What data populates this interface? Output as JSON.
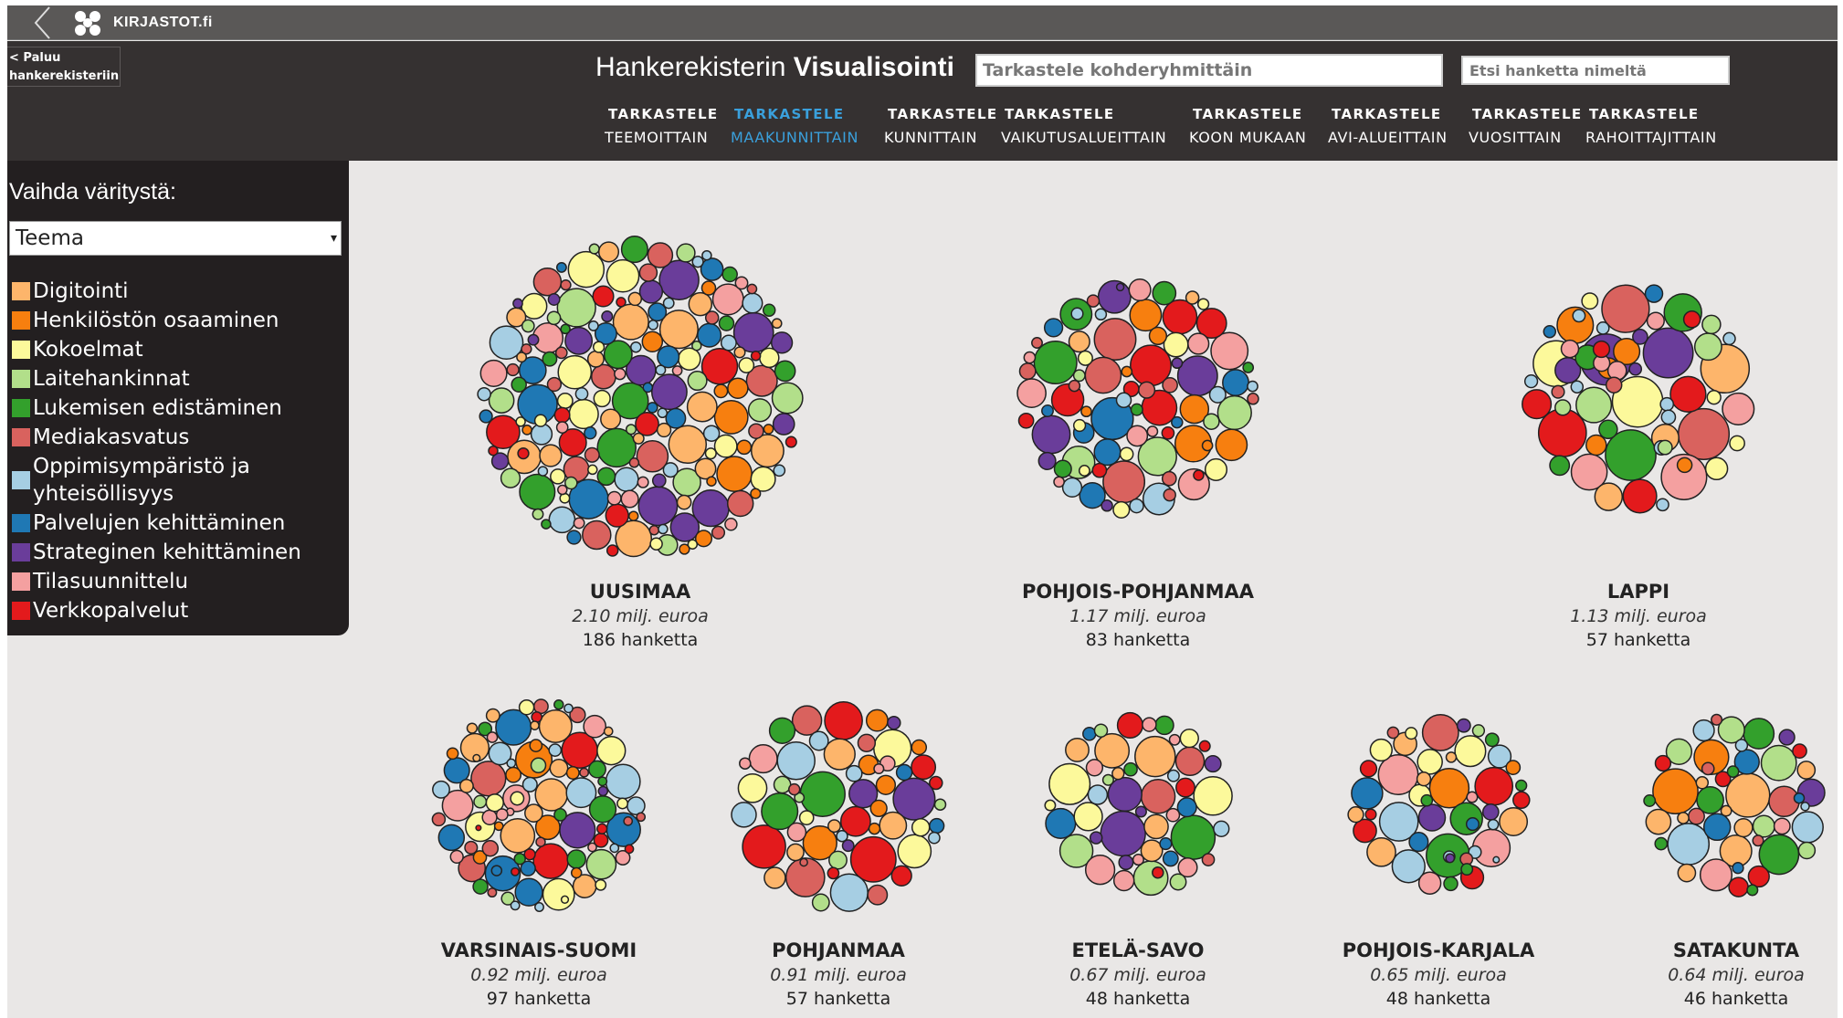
{
  "topbar": {
    "logo_text": "KIRJASTOT.fi"
  },
  "header": {
    "back_link": "< Paluu hankerekisteriin",
    "title_regular": "Hankerekisterin ",
    "title_bold": "Visualisointi",
    "group_search": {
      "value": "Tarkastele kohderyhmittäin"
    },
    "name_search": {
      "value": "Etsi hanketta nimeltä"
    },
    "nav_tabs": [
      {
        "line1": "TARKASTELE",
        "line2": "TEEMOITTAIN",
        "active": false
      },
      {
        "line1": "TARKASTELE",
        "line2": "MAAKUNNITTAIN",
        "active": true
      },
      {
        "line1": "TARKASTELE",
        "line2": "KUNNITTAIN",
        "active": false
      },
      {
        "line1": "TARKASTELE",
        "line2": "VAIKUTUSALUEITTAIN",
        "active": false
      },
      {
        "line1": "TARKASTELE",
        "line2": "KOON MUKAAN",
        "active": false
      },
      {
        "line1": "TARKASTELE",
        "line2": "AVI-ALUEITTAIN",
        "active": false
      },
      {
        "line1": "TARKASTELE",
        "line2": "VUOSITTAIN",
        "active": false
      },
      {
        "line1": "TARKASTELE",
        "line2": "RAHOITTAJITTAIN",
        "active": false
      }
    ]
  },
  "legend": {
    "title": "Vaihda väritystä:",
    "select_value": "Teema",
    "items": [
      {
        "label": "Digitointi",
        "color": "#fdb56b"
      },
      {
        "label": "Henkilöstön osaaminen",
        "color": "#f77f0f"
      },
      {
        "label": "Kokoelmat",
        "color": "#fcf99b"
      },
      {
        "label": "Laitehankinnat",
        "color": "#b2df8a"
      },
      {
        "label": "Lukemisen edistäminen",
        "color": "#33a02c"
      },
      {
        "label": "Mediakasvatus",
        "color": "#d9625e"
      },
      {
        "label": "Oppimisympäristö ja yhteisöllisyys",
        "color": "#a6cee3"
      },
      {
        "label": "Palvelujen kehittäminen",
        "color": "#1f78b4"
      },
      {
        "label": "Strateginen kehittäminen",
        "color": "#6a3d9a"
      },
      {
        "label": "Tilasuunnittelu",
        "color": "#f4a0a0"
      },
      {
        "label": "Verkkopalvelut",
        "color": "#e31a1c"
      }
    ]
  },
  "chart_data": {
    "type": "bubble-pack",
    "color_by": "Teema",
    "regions": [
      {
        "name": "UUSIMAA",
        "amount": "2.10 milj. euroa",
        "count": "186 hanketta",
        "projects": 186,
        "funding_meur": 2.1
      },
      {
        "name": "POHJOIS-POHJANMAA",
        "amount": "1.17 milj. euroa",
        "count": "83 hanketta",
        "projects": 83,
        "funding_meur": 1.17
      },
      {
        "name": "LAPPI",
        "amount": "1.13 milj. euroa",
        "count": "57 hanketta",
        "projects": 57,
        "funding_meur": 1.13
      },
      {
        "name": "VARSINAIS-SUOMI",
        "amount": "0.92 milj. euroa",
        "count": "97 hanketta",
        "projects": 97,
        "funding_meur": 0.92
      },
      {
        "name": "POHJANMAA",
        "amount": "0.91 milj. euroa",
        "count": "57 hanketta",
        "projects": 57,
        "funding_meur": 0.91
      },
      {
        "name": "ETELÄ-SAVO",
        "amount": "0.67 milj. euroa",
        "count": "48 hanketta",
        "projects": 48,
        "funding_meur": 0.67
      },
      {
        "name": "POHJOIS-KARJALA",
        "amount": "0.65 milj. euroa",
        "count": "48 hanketta",
        "projects": 48,
        "funding_meur": 0.65
      },
      {
        "name": "SATAKUNTA",
        "amount": "0.64 milj. euroa",
        "count": "46 hanketta",
        "projects": 46,
        "funding_meur": 0.64
      }
    ]
  }
}
